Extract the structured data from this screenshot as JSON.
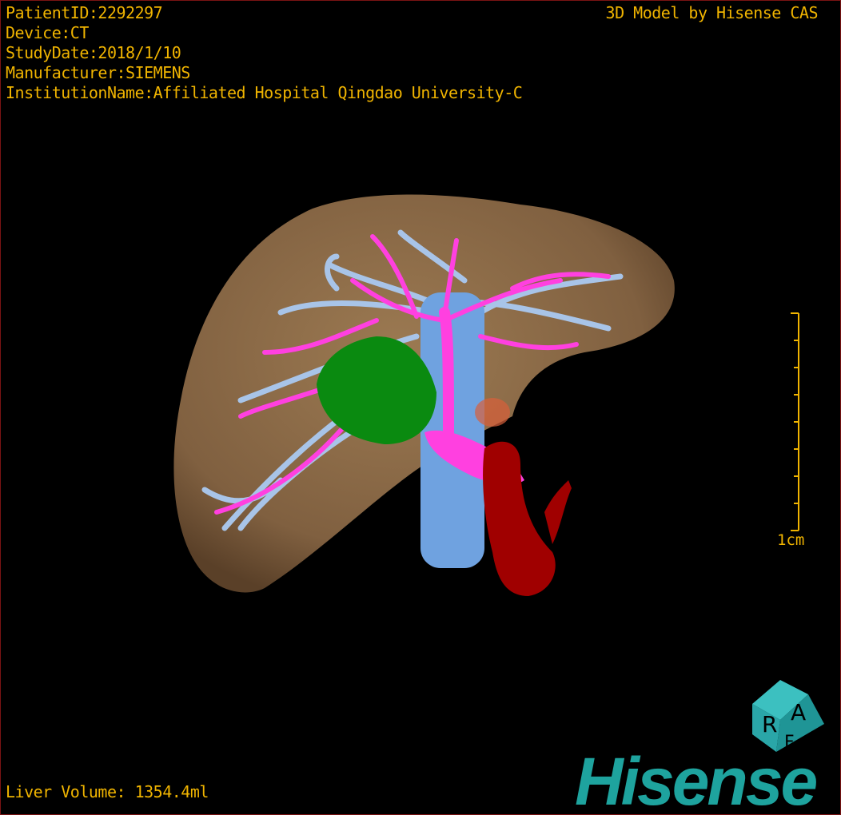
{
  "overlay": {
    "patient_id": "PatientID:2292297",
    "device": "Device:CT",
    "study_date": "StudyDate:2018/1/10",
    "manufacturer": "Manufacturer:SIEMENS",
    "institution": "InstitutionName:Affiliated Hospital Qingdao University-C",
    "brand_text": "3D Model by Hisense CAS",
    "liver_volume": "Liver Volume: 1354.4ml",
    "scale_label": "1cm"
  },
  "orientation_cube": {
    "faces": [
      "R",
      "A",
      "F"
    ],
    "color": "#2aa6a8"
  },
  "logo": {
    "text": "Hisense",
    "color": "#1ea39e"
  },
  "colors": {
    "text": "#f0b400",
    "liver": "#8a6a45",
    "portal_vein": "#ff40e0",
    "hepatic_vein": "#a8c4e8",
    "tumor": "#0a8a10",
    "vena_cava": "#6fa2e0",
    "artery": "#a00000",
    "border": "#7a1414"
  }
}
